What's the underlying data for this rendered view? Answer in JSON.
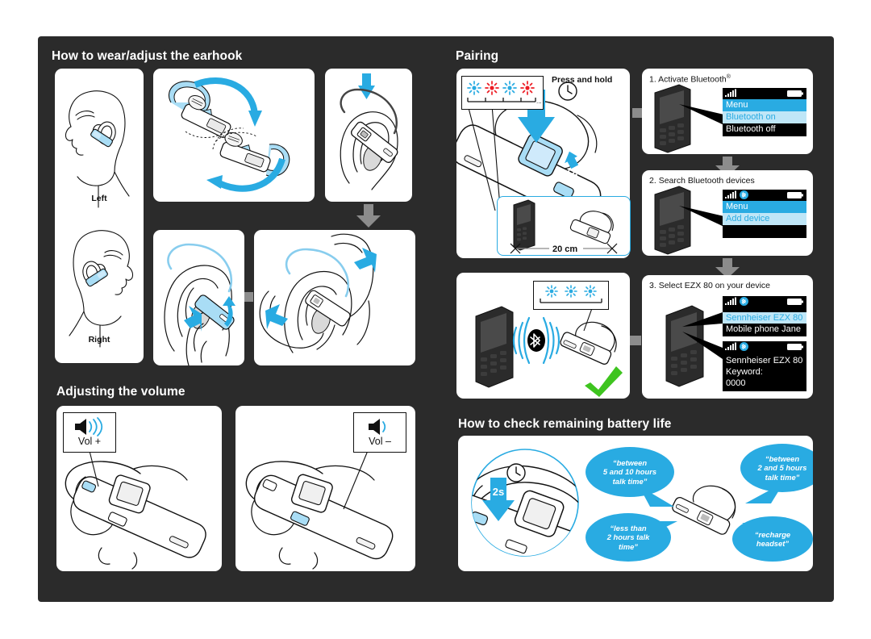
{
  "document": {
    "type": "headset-quick-guide",
    "product": "Sennheiser EZX 80",
    "background_color": "#2b2b2b",
    "accent_color": "#29abe2",
    "accent_light": "#bfe6f7",
    "red_color": "#ed1c24",
    "green_color": "#3ec41f",
    "grey_arrow_color": "#8c8c8c"
  },
  "sections": {
    "earhook": {
      "title": "How to wear/adjust the earhook"
    },
    "volume": {
      "title": "Adjusting the volume"
    },
    "pairing": {
      "title": "Pairing"
    },
    "battery": {
      "title": "How to check remaining battery life"
    }
  },
  "earhook": {
    "side_labels": {
      "left": "Left",
      "right": "Right"
    }
  },
  "volume": {
    "plus": {
      "label": "Vol +",
      "icon": "speaker-loud-icon"
    },
    "minus": {
      "label": "Vol –",
      "icon": "speaker-quiet-icon"
    }
  },
  "pairing": {
    "press_and_hold": "Press and hold",
    "power_switch": "ON",
    "distance": "20 cm",
    "led_pairing_sequence": [
      "blue",
      "red",
      "blue",
      "red"
    ],
    "led_pairing_trailing": "...",
    "led_connected_sequence": [
      "blue",
      "blue",
      "blue"
    ],
    "success_icon": "green-check-icon",
    "steps": [
      {
        "number": "1.",
        "caption_pre": "Activate Bluetooth",
        "caption_sup": "®",
        "screen": {
          "status_icons": [
            "signal-bars-icon",
            "battery-icon"
          ],
          "rows": [
            {
              "text": "Menu",
              "style": "sel-cyan"
            },
            {
              "text": "Bluetooth on",
              "style": "sel-lblue"
            },
            {
              "text": "Bluetooth off",
              "style": "sel-black"
            }
          ]
        }
      },
      {
        "number": "2.",
        "caption_pre": "Search Bluetooth devices",
        "caption_sup": "",
        "screen": {
          "status_icons": [
            "signal-bars-icon",
            "bluetooth-icon",
            "battery-icon"
          ],
          "rows": [
            {
              "text": "Menu",
              "style": "sel-cyan"
            },
            {
              "text": "Add device",
              "style": "sel-lblue"
            }
          ]
        }
      },
      {
        "number": "3.",
        "caption_pre": "Select EZX 80 on your device",
        "caption_sup": "",
        "screen_a": {
          "status_icons": [
            "signal-bars-icon",
            "bluetooth-icon",
            "battery-icon"
          ],
          "rows": [
            {
              "text": "Sennheiser EZX 80",
              "style": "sel-lblue"
            },
            {
              "text": "Mobile phone Jane",
              "style": "sel-black"
            }
          ]
        },
        "screen_b": {
          "status_icons": [
            "signal-bars-icon",
            "bluetooth-icon",
            "battery-icon"
          ],
          "rows": [
            {
              "text": "Sennheiser EZX 80",
              "style": "sel-black"
            },
            {
              "text": "Keyword:",
              "style": "sel-black"
            },
            {
              "text": "0000",
              "style": "sel-black"
            }
          ]
        }
      }
    ]
  },
  "battery": {
    "hold_duration": "2s",
    "bubbles": [
      {
        "id": "top-left",
        "text": "“between\n5 and 10 hours\ntalk time”"
      },
      {
        "id": "top-right",
        "text": "“between\n2 and 5 hours\ntalk time”"
      },
      {
        "id": "bottom-left",
        "text": "“less than\n2 hours talk\ntime”"
      },
      {
        "id": "bottom-right",
        "text": "“recharge\nheadset”"
      }
    ]
  }
}
